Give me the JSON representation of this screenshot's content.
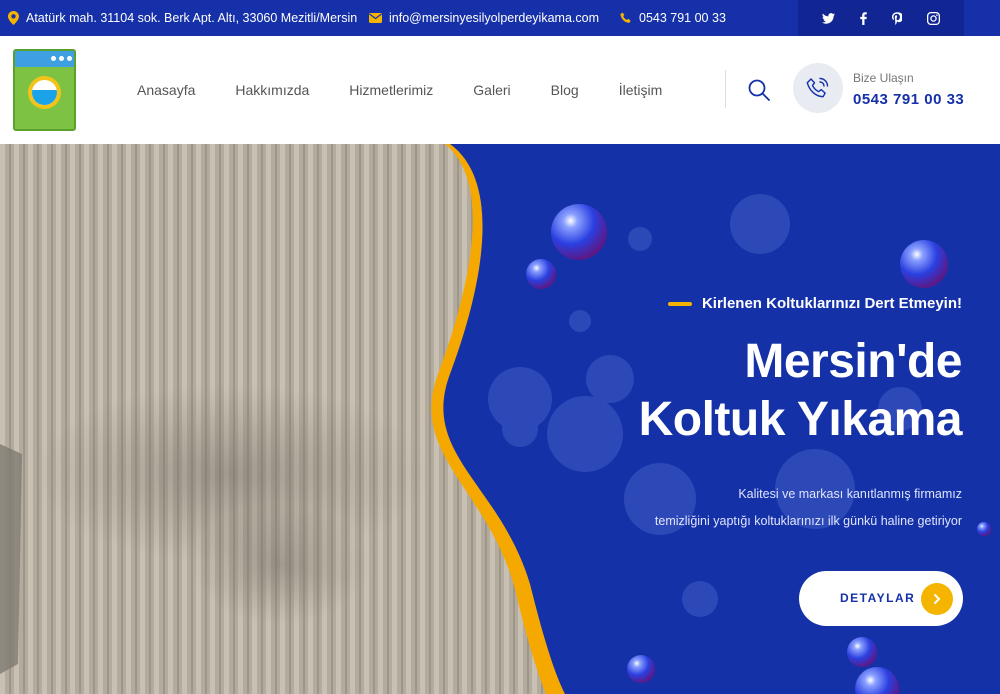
{
  "topbar": {
    "address": "Atatürk mah. 31104 sok. Berk Apt. Altı, 33060 Mezitli/Mersin",
    "email": "info@mersinyesilyolperdeyikama.com",
    "phone": "0543 791 00 33",
    "social": [
      "twitter-icon",
      "facebook-icon",
      "pinterest-icon",
      "instagram-icon"
    ]
  },
  "header": {
    "nav": [
      "Anasayfa",
      "Hakkımızda",
      "Hizmetlerimiz",
      "Galeri",
      "Blog",
      "İletişim"
    ],
    "contact_label": "Bize Ulaşın",
    "contact_phone": "0543 791 00 33"
  },
  "hero": {
    "subtitle": "Kirlenen Koltuklarınızı Dert Etmeyin!",
    "title_line1": "Mersin'de",
    "title_line2": "Koltuk Yıkama",
    "desc_line1": "Kalitesi ve markası kanıtlanmış firmamız",
    "desc_line2": "temizliğini yaptığı koltuklarınızı ilk günkü haline getiriyor",
    "cta_label": "DETAYLAR"
  },
  "colors": {
    "primary": "#1530a8",
    "accent": "#f5b400",
    "fabric": "#b2aa9c"
  }
}
